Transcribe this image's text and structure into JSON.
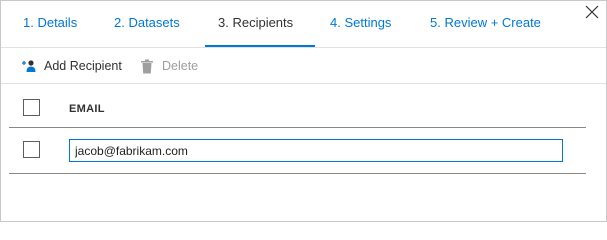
{
  "tabs": [
    {
      "label": "1. Details"
    },
    {
      "label": "2. Datasets"
    },
    {
      "label": "3. Recipients"
    },
    {
      "label": "4. Settings"
    },
    {
      "label": "5. Review + Create"
    }
  ],
  "active_tab": "3. Recipients",
  "toolbar": {
    "add_label": "Add Recipient",
    "delete_label": "Delete"
  },
  "table": {
    "column_header": "EMAIL",
    "rows": [
      {
        "email": "jacob@fabrikam.com"
      }
    ]
  },
  "icons": {
    "close": "close-icon",
    "add_recipient": "add-person-icon",
    "delete": "trash-icon"
  },
  "colors": {
    "accent": "#0078d4",
    "text": "#323130",
    "disabled": "#a19f9d"
  }
}
